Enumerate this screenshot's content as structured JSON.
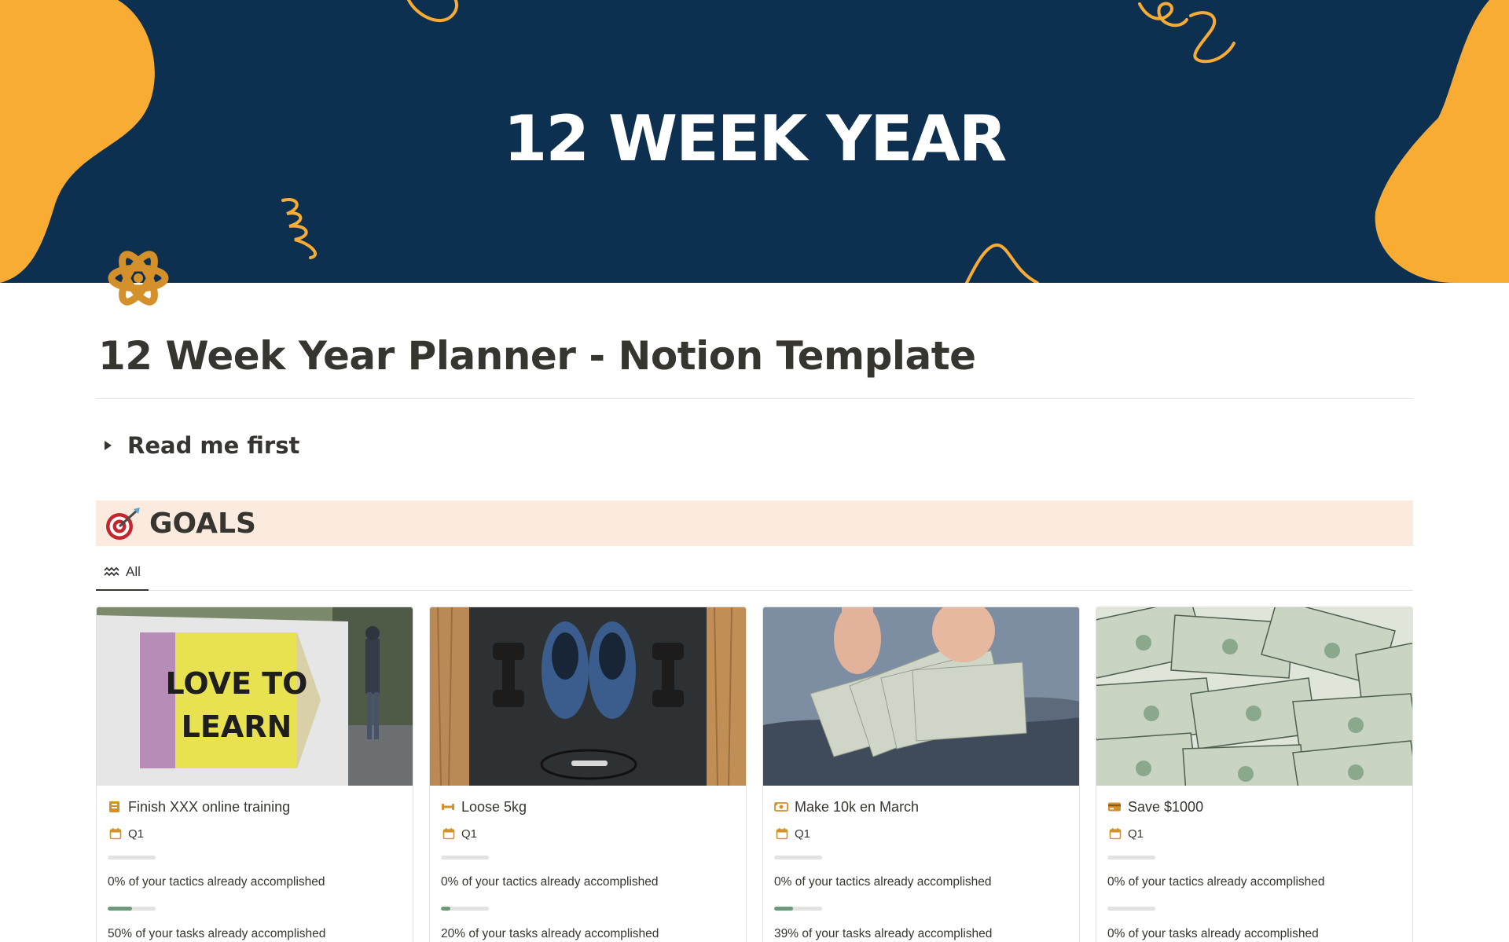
{
  "banner": {
    "title": "12 WEEK YEAR"
  },
  "page": {
    "icon": "atom-icon",
    "title": "12 Week Year Planner - Notion Template",
    "toggle_label": "Read me first"
  },
  "goals": {
    "heading_emoji": "direct-hit-icon",
    "heading": "GOALS",
    "view_tab_label": "All",
    "view_tab_icon": "gallery-view-icon"
  },
  "colors": {
    "banner_bg": "#0e3050",
    "banner_accent": "#f9ac33",
    "callout_bg": "#fbebdf",
    "progress_fill": "#6d9b7a",
    "icon_accent": "#d4902a"
  },
  "cards": [
    {
      "cover": "pencil-sign-photo",
      "cover_text_line1": "LOVE TO",
      "cover_text_line2": "LEARN",
      "icon": "training-icon",
      "title": "Finish XXX online training",
      "quarter": "Q1",
      "tactics_progress": 0,
      "tactics_text": "0% of your tactics already accomplished",
      "tasks_progress": 0.5,
      "tasks_text": "50% of your tasks already accomplished"
    },
    {
      "cover": "dumbbells-sneakers-photo",
      "icon": "dumbbell-icon",
      "title": "Loose 5kg",
      "quarter": "Q1",
      "tactics_progress": 0,
      "tactics_text": "0% of your tactics already accomplished",
      "tasks_progress": 0.2,
      "tasks_text": "20% of your tasks already accomplished"
    },
    {
      "cover": "hands-counting-money-photo",
      "icon": "money-icon",
      "title": "Make 10k en March",
      "quarter": "Q1",
      "tactics_progress": 0,
      "tactics_text": "0% of your tactics already accomplished",
      "tasks_progress": 0.39,
      "tasks_text": "39% of your tasks already accomplished"
    },
    {
      "cover": "dollar-bills-photo",
      "icon": "credit-card-icon",
      "title": "Save $1000",
      "quarter": "Q1",
      "tactics_progress": 0,
      "tactics_text": "0% of your tactics already accomplished",
      "tasks_progress": 0,
      "tasks_text": "0% of your tasks already accomplished"
    }
  ]
}
